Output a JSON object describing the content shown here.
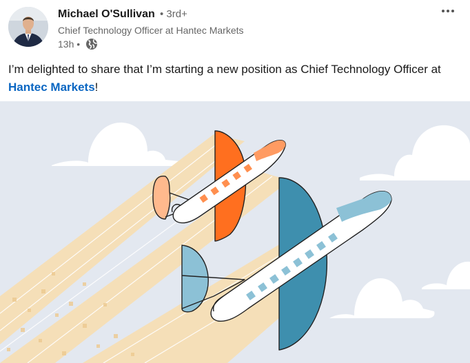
{
  "post": {
    "author": {
      "name": "Michael O'Sullivan",
      "degree": "• 3rd+",
      "headline": "Chief Technology Officer at Hantec Markets",
      "time": "13h •",
      "visibility_icon": "globe-icon"
    },
    "more_icon": "more-horizontal-icon",
    "text_before": "I’m delighted to share that I’m starting a new position as Chief Technology Officer at ",
    "mention": "Hantec Markets",
    "text_after": "!",
    "image": {
      "description_icons": [
        "airplane-icon",
        "airplane-icon",
        "cloud-icon"
      ],
      "colors": {
        "sky": "#e3e8f0",
        "trail": "#f5dfb8",
        "orange": "#ff6f1f",
        "orange_light": "#ffb98d",
        "blue": "#3e8fae",
        "blue_light": "#8cc1d6"
      }
    }
  }
}
